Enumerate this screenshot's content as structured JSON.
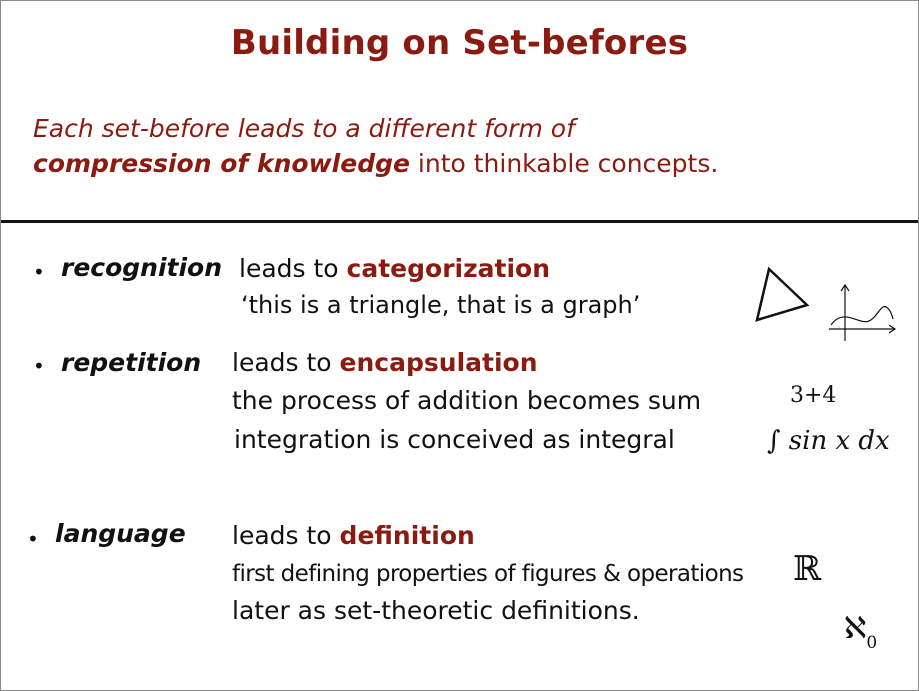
{
  "title": "Building on Set-befores",
  "intro": {
    "line1": "Each set-before leads to a different form of",
    "line2_em": "compression of knowledge",
    "line2_rest": " into thinkable concepts."
  },
  "items": [
    {
      "keyword": "recognition",
      "leads_to": "leads to ",
      "result": "categorization",
      "details": [
        "‘this is a triangle, that is a graph’"
      ],
      "icons": [
        "triangle-icon",
        "graph-axes-icon"
      ]
    },
    {
      "keyword": "repetition",
      "leads_to": "leads to ",
      "result": "encapsulation",
      "details": [
        "the process of addition becomes sum",
        "integration is conceived as integral"
      ],
      "symbols": {
        "sum": "3+4",
        "integral": "∫ sin x dx"
      }
    },
    {
      "keyword": "language",
      "leads_to": "leads to ",
      "result": "definition",
      "details": [
        "first defining properties of figures & operations",
        "later as set-theoretic definitions."
      ],
      "symbols": {
        "reals": "ℝ",
        "aleph": "ℵ",
        "aleph_sub": "0"
      }
    }
  ],
  "bullet": "•"
}
